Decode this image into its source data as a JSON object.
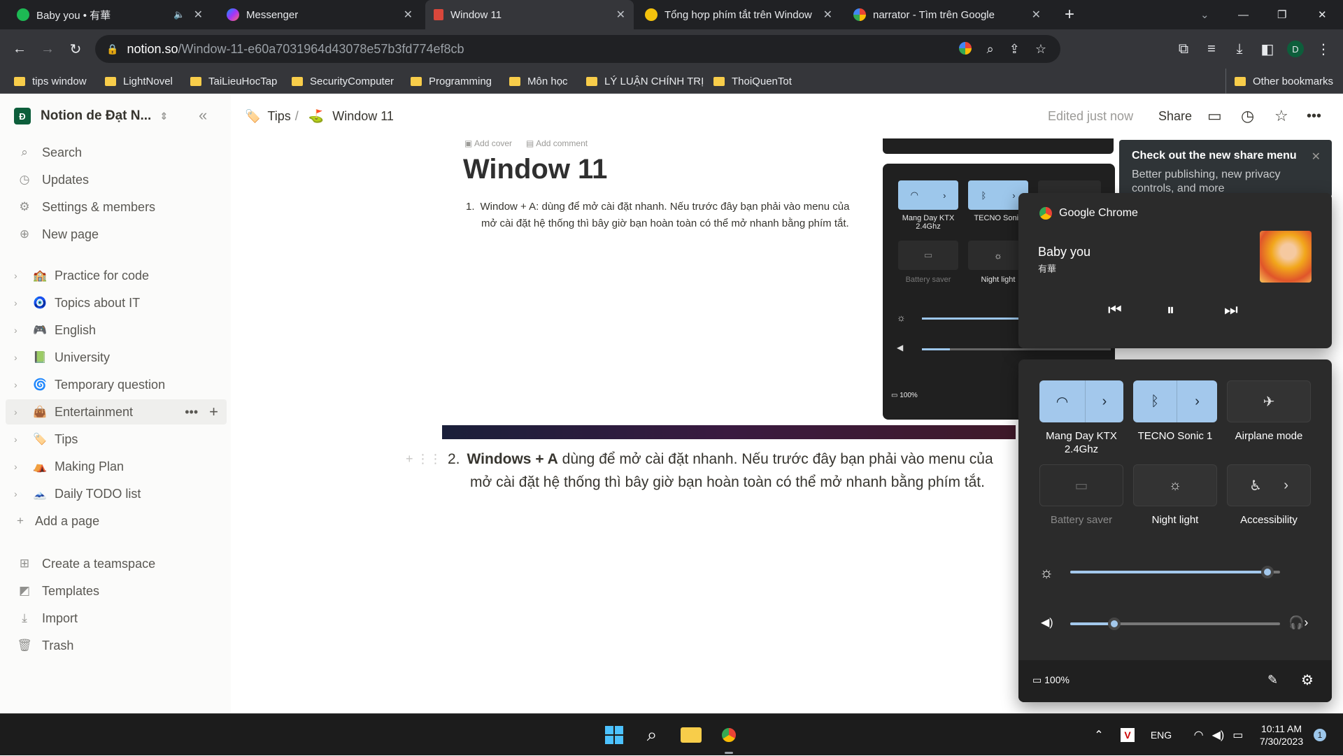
{
  "browser": {
    "tabs": [
      {
        "title": "Baby you • 有華",
        "favicon": "spotify-icon",
        "audio": "🔈"
      },
      {
        "title": "Messenger",
        "favicon": "messenger-icon"
      },
      {
        "title": "Window 11",
        "favicon": "notion-page-icon",
        "active": true
      },
      {
        "title": "Tổng hợp phím tắt trên Window",
        "favicon": "site-icon"
      },
      {
        "title": "narrator - Tìm trên Google",
        "favicon": "google-icon"
      }
    ],
    "url_host": "notion.so",
    "url_path": "/Window-11-e60a7031964d43078e57b3fd774ef8cb",
    "profile_initial": "D",
    "bookmarks": [
      "tips window",
      "LightNovel",
      "TaiLieuHocTap",
      "SecurityComputer",
      "Programming",
      "Môn học",
      "LÝ LUẬN CHÍNH TRỊ",
      "ThoiQuenTot"
    ],
    "other_bookmarks": "Other bookmarks"
  },
  "sidebar": {
    "workspace_initial": "Đ",
    "workspace": "Notion de Đạt N...",
    "nav": [
      {
        "icon": "search-icon",
        "label": "Search"
      },
      {
        "icon": "clock-icon",
        "label": "Updates"
      },
      {
        "icon": "gear-icon",
        "label": "Settings & members"
      },
      {
        "icon": "plus-circle-icon",
        "label": "New page"
      }
    ],
    "pages": [
      {
        "emoji": "🏫",
        "label": "Practice for code"
      },
      {
        "emoji": "🧿",
        "label": "Topics about IT"
      },
      {
        "emoji": "🎮",
        "label": "English"
      },
      {
        "emoji": "📗",
        "label": "University"
      },
      {
        "emoji": "🌀",
        "label": "Temporary question"
      },
      {
        "emoji": "👜",
        "label": "Entertainment",
        "hover": true
      },
      {
        "emoji": "🏷️",
        "label": "Tips"
      },
      {
        "emoji": "⛺",
        "label": "Making Plan"
      },
      {
        "emoji": "🗻",
        "label": "Daily TODO list"
      }
    ],
    "add_page": "Add a page",
    "bottom": [
      {
        "icon": "teamspace-icon",
        "label": "Create a teamspace"
      },
      {
        "icon": "templates-icon",
        "label": "Templates"
      },
      {
        "icon": "import-icon",
        "label": "Import"
      },
      {
        "icon": "trash-icon",
        "label": "Trash"
      }
    ]
  },
  "topbar": {
    "crumb_parent": "Tips",
    "crumb_sep": "/",
    "crumb_current": "Window 11",
    "edited": "Edited just now",
    "share": "Share"
  },
  "page": {
    "screenshot": {
      "add_cover": "Add cover",
      "add_comment": "Add comment",
      "title": "Window 11",
      "item_num": "1.",
      "item_text": "Window + A: dùng để mở cài đặt nhanh. Nếu trước đây bạn phải vào menu của",
      "item_text2": "mở cài đặt hệ thống thì bây giờ bạn hoàn toàn có thể mở nhanh bằng phím tắt.",
      "qs_tiles": [
        "Mang Day KTX 2.4Ghz",
        "TECNO Sonic",
        "Battery saver",
        "Night light"
      ],
      "battery": "100%"
    },
    "item_num": "2.",
    "item_bold": "Windows + A",
    "item_rest": " dùng để mở cài đặt nhanh. Nếu trước đây bạn phải vào menu của",
    "item_line2": "mở cài đặt hệ thống thì bây giờ bạn hoàn toàn có thể mở nhanh bằng phím tắt."
  },
  "toast": {
    "title": "Check out the new share menu",
    "body": "Better publishing, new privacy controls, and more"
  },
  "media": {
    "source": "Google Chrome",
    "track": "Baby you",
    "artist": "有華"
  },
  "quick_settings": {
    "tiles": [
      {
        "label": "Mang Day KTX 2.4Ghz",
        "icon": "wifi-icon",
        "on": true
      },
      {
        "label": "TECNO Sonic 1",
        "icon": "bluetooth-icon",
        "on": true
      },
      {
        "label": "Airplane mode",
        "icon": "airplane-icon",
        "on": false
      },
      {
        "label": "Battery saver",
        "icon": "battery-saver-icon",
        "on": false,
        "disabled": true
      },
      {
        "label": "Night light",
        "icon": "night-light-icon",
        "on": false
      },
      {
        "label": "Accessibility",
        "icon": "accessibility-icon",
        "on": false
      }
    ],
    "brightness": 0.94,
    "volume": 0.21,
    "battery": "100%"
  },
  "taskbar": {
    "lang": "ENG",
    "time": "10:11 AM",
    "date": "7/30/2023",
    "notif_count": "1"
  }
}
